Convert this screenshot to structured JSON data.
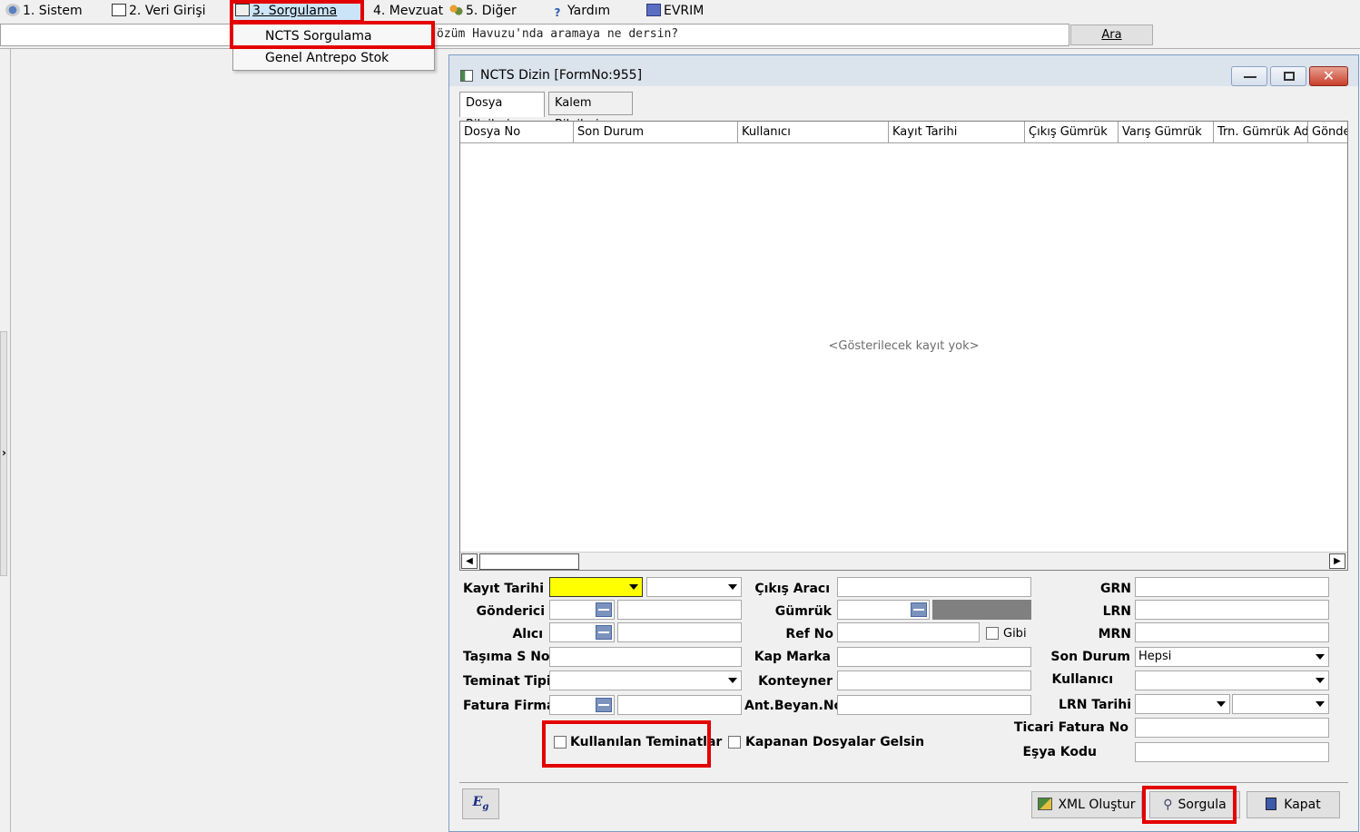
{
  "menubar": {
    "items": [
      "1. Sistem",
      "2. Veri Girişi",
      "3. Sorgulama",
      "4. Mevzuat",
      "5. Diğer",
      "Yardım",
      "EVRIM"
    ]
  },
  "search": {
    "hint": "özüm Havuzu'nda aramaya ne dersin?",
    "button": "Ara"
  },
  "dropdown": {
    "items": [
      "NCTS Sorgulama",
      "Genel Antrepo Stok"
    ]
  },
  "window": {
    "title": "NCTS Dizin [FormNo:955]",
    "tabs": [
      "Dosya Bilgileri",
      "Kalem Bilgileri"
    ],
    "columns": [
      "Dosya No",
      "Son Durum",
      "Kullanıcı",
      "Kayıt Tarihi",
      "Çıkış Gümrük",
      "Varış Gümrük",
      "Trn. Gümrük Ad",
      "Gönde"
    ],
    "empty_text": "<Gösterilecek kayıt yok>"
  },
  "form": {
    "kayit_tarihi": "Kayıt Tarihi",
    "gonderici": "Gönderici",
    "alici": "Alıcı",
    "tasima_s_no": "Taşıma S No",
    "teminat_tipi": "Teminat Tipi",
    "fatura_firma": "Fatura Firma",
    "cikis_araci": "Çıkış Aracı",
    "gumruk": "Gümrük",
    "ref_no": "Ref No",
    "gibi": "Gibi",
    "kap_marka": "Kap Marka",
    "konteyner": "Konteyner",
    "ant_beyan_no": "Ant.Beyan.No",
    "grn": "GRN",
    "lrn": "LRN",
    "mrn": "MRN",
    "son_durum": "Son Durum",
    "son_durum_value": "Hepsi",
    "kullanici": "Kullanıcı",
    "lrn_tarihi": "LRN Tarihi",
    "ticari_fatura_no": "Ticari Fatura No",
    "esya_kodu": "Eşya Kodu",
    "kullanilan_teminatlar": "Kullanılan Teminatlar",
    "kapanan_dosyalar": "Kapanan Dosyalar Gelsin"
  },
  "buttons": {
    "xml": "XML Oluştur",
    "sorgula": "Sorgula",
    "kapat": "Kapat"
  },
  "colors": {
    "highlight_red": "#e30000",
    "date_input_yellow": "#ffff00",
    "gumruk_name_gray": "#808080"
  }
}
